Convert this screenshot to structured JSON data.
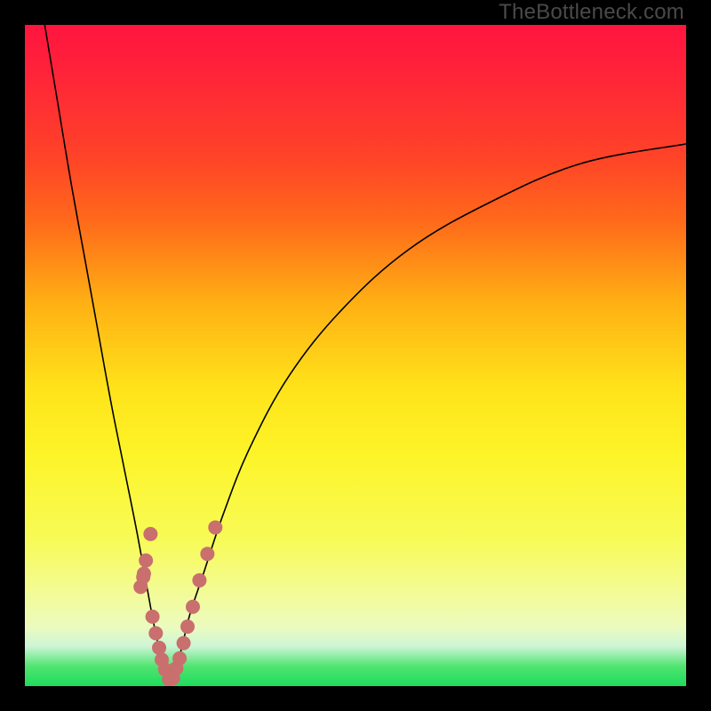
{
  "watermark": "TheBottleneck.com",
  "chart_data": {
    "type": "line",
    "title": "",
    "xlabel": "",
    "ylabel": "",
    "xlim": [
      0,
      100
    ],
    "ylim": [
      0,
      100
    ],
    "x_at_min": 22,
    "y_at_right_edge": 82,
    "left_branch": {
      "name": "left",
      "x": [
        3,
        5,
        7,
        9,
        11,
        13,
        15,
        17,
        19,
        20,
        21,
        22
      ],
      "y": [
        100,
        88,
        76,
        65,
        54,
        43,
        33,
        23,
        12,
        7,
        3,
        0
      ]
    },
    "right_branch": {
      "name": "right",
      "x": [
        22,
        23,
        24,
        25,
        27,
        30,
        34,
        40,
        48,
        58,
        70,
        84,
        100
      ],
      "y": [
        0,
        3,
        7,
        11,
        17,
        26,
        36,
        47,
        57,
        66,
        73,
        79,
        82
      ]
    },
    "marker_clusters": [
      {
        "name": "left-cluster",
        "points": [
          [
            19.0,
            23
          ],
          [
            18.3,
            19
          ],
          [
            18.0,
            17
          ],
          [
            17.5,
            15
          ],
          [
            17.9,
            16.5
          ],
          [
            19.3,
            10.5
          ],
          [
            19.8,
            8
          ],
          [
            20.3,
            5.8
          ],
          [
            20.7,
            4
          ],
          [
            21.2,
            2.5
          ],
          [
            21.8,
            1
          ]
        ]
      },
      {
        "name": "right-cluster",
        "points": [
          [
            22.4,
            1.2
          ],
          [
            22.9,
            2.7
          ],
          [
            23.4,
            4.2
          ],
          [
            24.0,
            6.5
          ],
          [
            24.6,
            9
          ],
          [
            25.4,
            12
          ],
          [
            26.4,
            16
          ],
          [
            27.6,
            20
          ],
          [
            28.8,
            24
          ]
        ]
      }
    ],
    "marker_style": {
      "color": "#c96f6e",
      "radius_px": 8
    }
  }
}
